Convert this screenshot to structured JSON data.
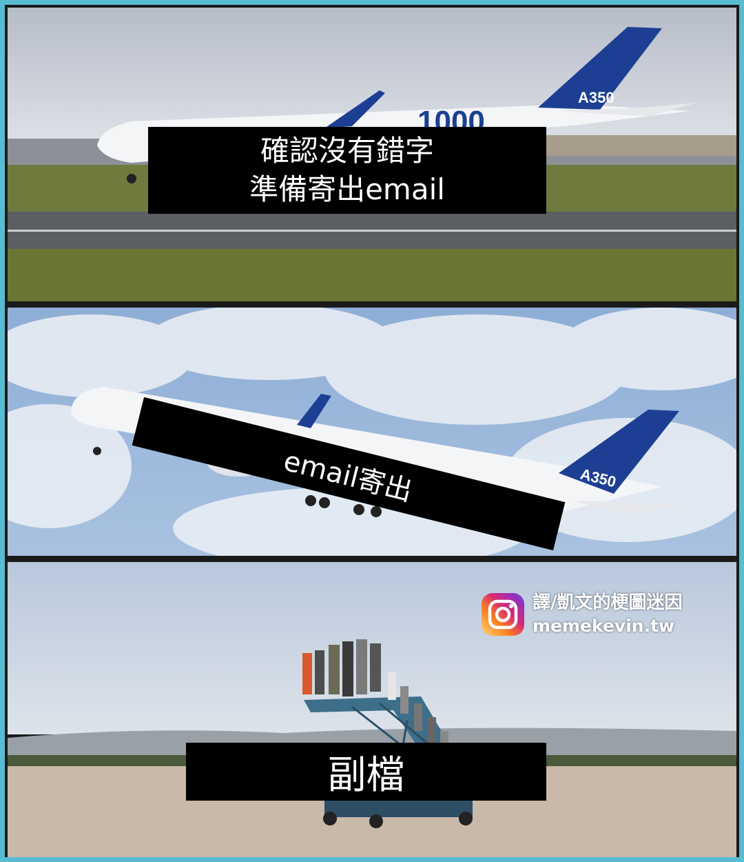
{
  "panels": [
    {
      "caption_lines": [
        "確認沒有錯字",
        "準備寄出email"
      ],
      "plane_tail_text": "A350",
      "plane_fuselage_text": "1000"
    },
    {
      "caption_lines": [
        "email寄出"
      ],
      "plane_tail_text": "A350"
    },
    {
      "caption_lines": [
        "副檔"
      ]
    }
  ],
  "watermark": {
    "line1": "譯/凱文的梗圖迷因",
    "line2": "memekevin.tw",
    "icon": "instagram-icon"
  },
  "colors": {
    "border": "#58bcd3",
    "caption_bg": "#000000",
    "caption_text": "#ffffff",
    "airbus_blue": "#1d3f93"
  }
}
